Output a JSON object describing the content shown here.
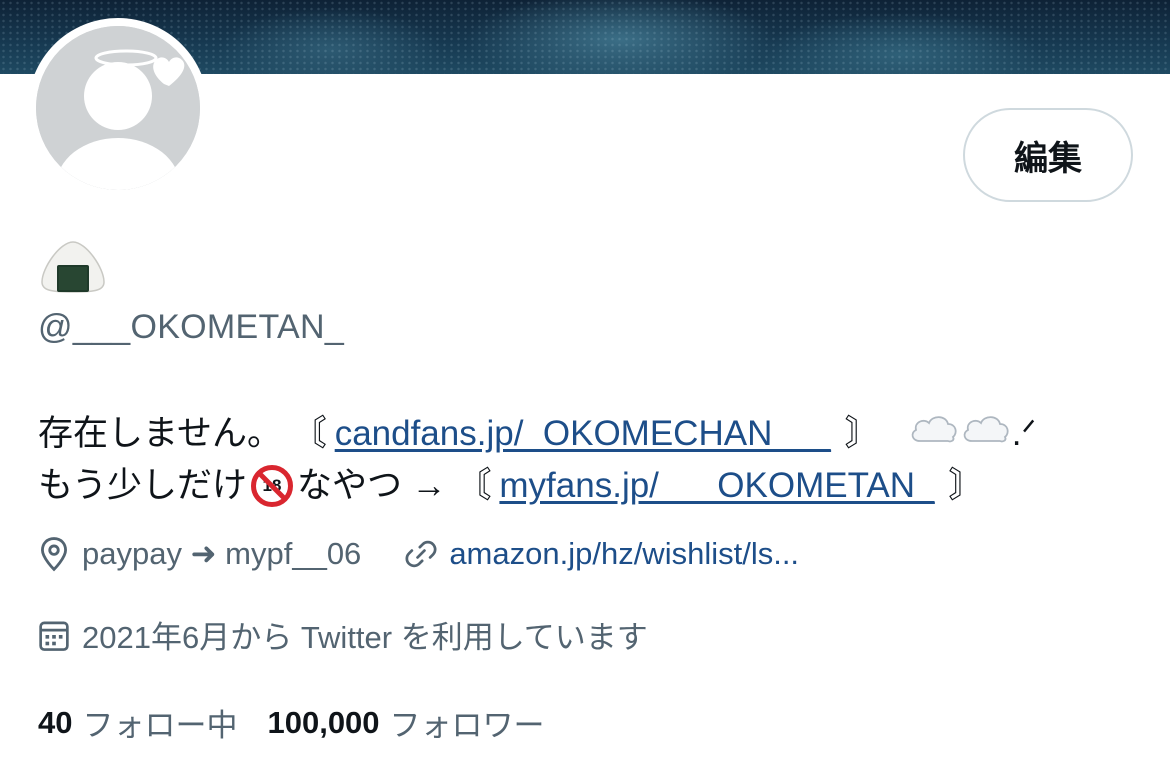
{
  "profile": {
    "edit_label": "編集",
    "handle": "@___OKOMETAN_",
    "name_emoji": "rice-ball-emoji"
  },
  "bio": {
    "line1_text": "存在しません。 〘",
    "line1_link": "candfans.jp/_OKOMECHAN___",
    "line1_close": "〙",
    "line1_tail": ".ᐟ",
    "line2_text": "もう少しだけ",
    "line2_badge": "18",
    "line2_mid": "なやつ →  〘",
    "line2_link": "myfans.jp/___OKOMETAN_",
    "line2_close": "〙"
  },
  "meta": {
    "location": "paypay ➜ mypf__06",
    "website": "amazon.jp/hz/wishlist/ls...",
    "joined": "2021年6月から Twitter を利用しています"
  },
  "stats": {
    "following_count": "40",
    "following_label": "フォロー中",
    "followers_count": "100,000",
    "followers_label": "フォロワー"
  },
  "colors": {
    "link": "#1d4e89",
    "secondary_text": "#536471",
    "border": "#cfd9de"
  },
  "icons": [
    "location-pin-icon",
    "link-icon",
    "calendar-icon",
    "cloud-emoji",
    "no-under-18-emoji",
    "halo-icon",
    "heart-icon"
  ]
}
